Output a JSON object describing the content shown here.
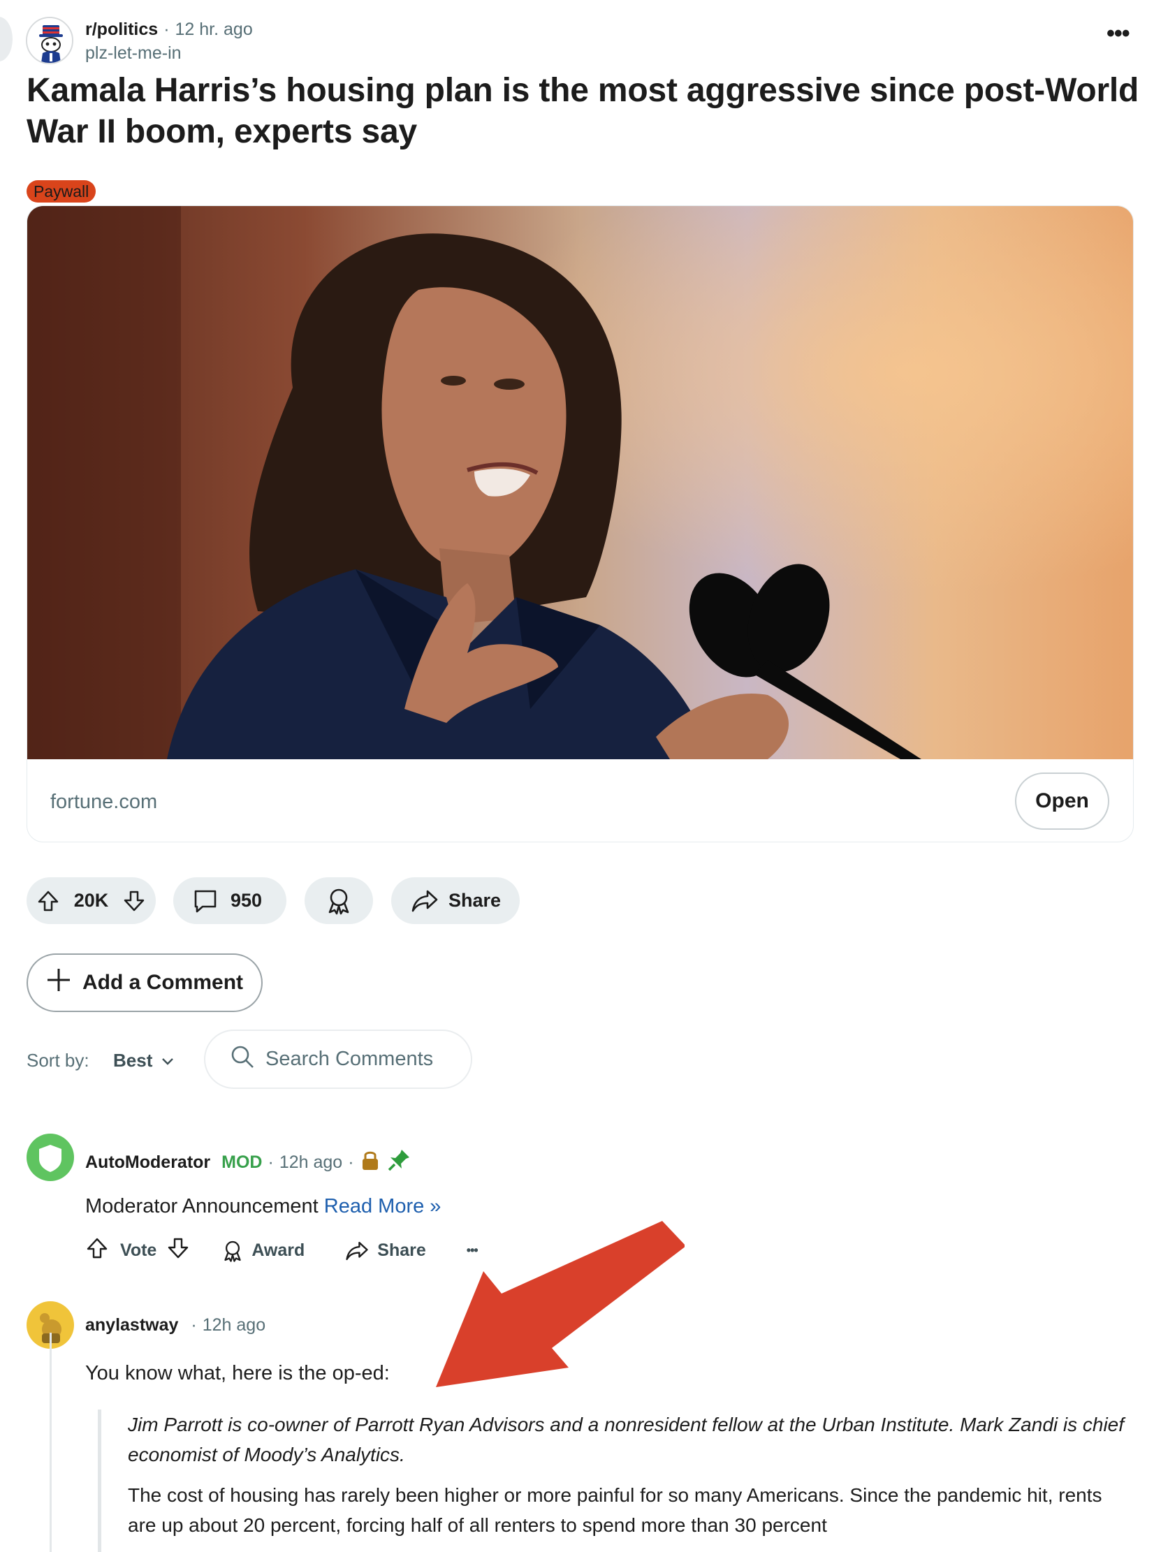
{
  "post": {
    "subreddit": "r/politics",
    "time": "12 hr. ago",
    "author": "plz-let-me-in",
    "more_icon": "ellipsis-icon",
    "title": "Kamala Harris’s housing plan is the most aggressive since post-World War II boom, experts say",
    "flair": "Paywall",
    "flair_color": "#d9441b"
  },
  "link_card": {
    "domain": "fortune.com",
    "open_label": "Open"
  },
  "actions": {
    "votes": "20K",
    "comments": "950",
    "share_label": "Share"
  },
  "add_comment_label": "Add a Comment",
  "sort": {
    "label": "Sort by:",
    "value": "Best"
  },
  "search": {
    "placeholder": "Search Comments"
  },
  "comments": [
    {
      "author": "AutoModerator",
      "badge": "MOD",
      "time": "12h ago",
      "body_text": "Moderator Announcement",
      "body_link": "Read More »",
      "vote_label": "Vote",
      "award_label": "Award",
      "share_label": "Share"
    },
    {
      "author": "anylastway",
      "time": "12h ago",
      "body_text": "You know what, here is the op-ed:",
      "quote_italic": "Jim Parrott is co-owner of Parrott Ryan Advisors and a nonresident fellow at the Urban Institute. Mark Zandi is chief economist of Moody’s Analytics.",
      "quote_text": "The cost of housing has rarely been higher or more painful for so many Americans. Since the pandemic hit, rents are up about 20 percent, forcing half of all renters to spend more than 30 percent"
    }
  ],
  "colors": {
    "accent_link": "#1e5fae",
    "mod_green": "#37a04b",
    "annotation_arrow": "#d9402b"
  }
}
